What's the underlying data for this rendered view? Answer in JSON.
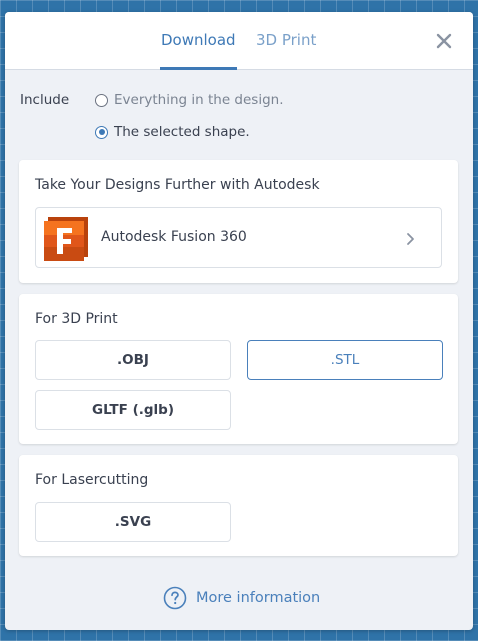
{
  "tabs": [
    {
      "label": "Download",
      "active": true
    },
    {
      "label": "3D Print",
      "active": false
    }
  ],
  "include": {
    "label": "Include",
    "options": [
      {
        "label": "Everything in the design.",
        "checked": false
      },
      {
        "label": "The selected shape.",
        "checked": true
      }
    ]
  },
  "autodesk_card": {
    "title": "Take Your Designs Further with Autodesk",
    "product_label": "Autodesk Fusion 360",
    "logo_letter": "F"
  },
  "print_card": {
    "title": "For 3D Print",
    "buttons": [
      ".OBJ",
      ".STL",
      "GLTF (.glb)"
    ],
    "selected": ".STL"
  },
  "laser_card": {
    "title": "For Lasercutting",
    "buttons": [
      ".SVG"
    ]
  },
  "footer": {
    "more_info": "More information"
  },
  "colors": {
    "accent": "#3e79b6",
    "background": "#2f73a8",
    "fusion_orange": "#f26a1b"
  }
}
